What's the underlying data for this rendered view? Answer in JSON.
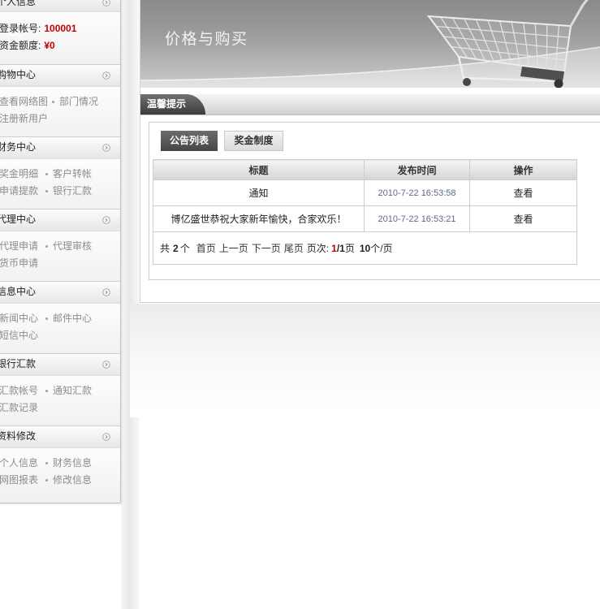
{
  "sidebar": {
    "profile": {
      "title": "个人信息",
      "account_label": "登录帐号:",
      "account_value": "100001",
      "balance_label": "资金额度:",
      "balance_value": "¥0"
    },
    "toggle_icon": "circle-arrow-icon",
    "sections": [
      {
        "title": "购物中心",
        "rows": [
          [
            "查看网络图",
            "部门情况"
          ],
          [
            "注册新用户"
          ]
        ]
      },
      {
        "title": "财务中心",
        "rows": [
          [
            "奖金明细",
            "客户转帐"
          ],
          [
            "申请提款",
            "银行汇款"
          ]
        ]
      },
      {
        "title": "代理中心",
        "rows": [
          [
            "代理申请",
            "代理审核"
          ],
          [
            "货币申请"
          ]
        ]
      },
      {
        "title": "信息中心",
        "rows": [
          [
            "新闻中心",
            "邮件中心"
          ],
          [
            "短信中心"
          ]
        ]
      },
      {
        "title": "银行汇款",
        "rows": [
          [
            "汇款帐号",
            "通知汇款"
          ],
          [
            "汇款记录"
          ]
        ]
      },
      {
        "title": "资料修改",
        "rows": [
          [
            "个人信息",
            "财务信息"
          ],
          [
            "网图报表",
            "修改信息"
          ]
        ]
      }
    ]
  },
  "banner": {
    "title": "价格与购买",
    "image_icon": "shopping-cart-icon"
  },
  "notice": {
    "title": "温馨提示",
    "tabs": [
      {
        "label": "公告列表",
        "active": true
      },
      {
        "label": "奖金制度",
        "active": false
      }
    ],
    "table": {
      "headers": [
        "标题",
        "发布时间",
        "操作"
      ],
      "rows": [
        {
          "title": "通知",
          "time": "2010-7-22 16:53:58",
          "action": "查看"
        },
        {
          "title": "博亿盛世恭祝大家新年愉快，合家欢乐！",
          "time": "2010-7-22 16:53:21",
          "action": "查看"
        }
      ]
    },
    "pagination": {
      "total_prefix": "共",
      "total_count": "2",
      "total_suffix": "个",
      "first": "首页",
      "prev": "上一页",
      "next": "下一页",
      "last": "尾页",
      "page_label": "页次:",
      "current_page": "1",
      "total_pages": "/1",
      "page_unit": "页",
      "per_page": "10",
      "per_page_unit": "个/页"
    }
  },
  "colors": {
    "accent_red": "#c40000",
    "tab_dark": "#3b3b3b",
    "date_text": "#5a6a88",
    "menu_text": "#8c8c8c"
  }
}
